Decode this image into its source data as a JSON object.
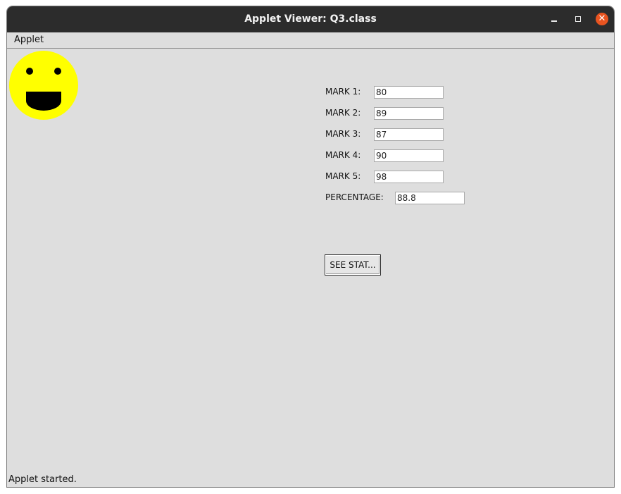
{
  "window": {
    "title": "Applet Viewer: Q3.class",
    "controls": {
      "minimize_icon": "minimize-icon",
      "maximize_icon": "maximize-icon",
      "close_icon": "close-icon",
      "close_glyph": "✕",
      "close_color": "#e95420"
    }
  },
  "menubar": {
    "items": [
      {
        "label": "Applet"
      }
    ]
  },
  "face": {
    "icon": "smiley-face-icon",
    "color": "#ffff00"
  },
  "form": {
    "marks": [
      {
        "label": "MARK 1:",
        "value": "80"
      },
      {
        "label": "MARK 2:",
        "value": "89"
      },
      {
        "label": "MARK 3:",
        "value": "87"
      },
      {
        "label": "MARK 4:",
        "value": "90"
      },
      {
        "label": "MARK 5:",
        "value": "98"
      }
    ],
    "percentage": {
      "label": "PERCENTAGE:",
      "value": "88.8"
    },
    "button_label": "SEE STAT..."
  },
  "status": "Applet started."
}
